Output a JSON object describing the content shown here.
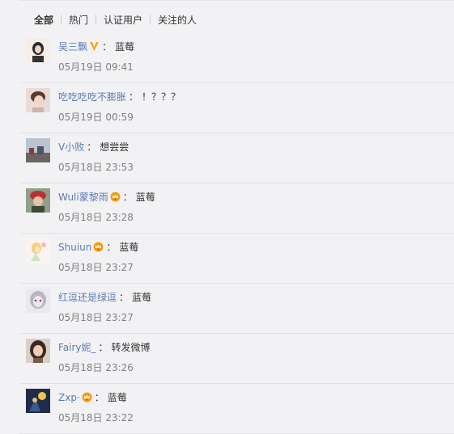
{
  "tabs": [
    "全部",
    "热门",
    "认证用户",
    "关注的人"
  ],
  "comments": [
    {
      "name": "吴三飘",
      "badge": "verified-v-icon",
      "text": "蓝莓",
      "time": "05月19日 09:41"
    },
    {
      "name": "吃吃吃吃不膨胀",
      "badge": "",
      "text": "！？？？",
      "time": "05月19日 00:59"
    },
    {
      "name": "V小败",
      "badge": "",
      "text": "想尝尝",
      "time": "05月18日 23:53"
    },
    {
      "name": "Wuli蒙黎雨",
      "badge": "crown-badge-icon",
      "text": "蓝莓",
      "time": "05月18日 23:28"
    },
    {
      "name": "Shuiun",
      "badge": "crown-badge-icon",
      "text": "蓝莓",
      "time": "05月18日 23:27"
    },
    {
      "name": "红逗还是绿逗",
      "badge": "",
      "text": "蓝莓",
      "time": "05月18日 23:27"
    },
    {
      "name": "Fairy妮_",
      "badge": "",
      "text": "转发微博",
      "time": "05月18日 23:26"
    },
    {
      "name": "Zxp·",
      "badge": "crown-badge-icon",
      "text": "蓝莓",
      "time": "05月18日 23:22"
    }
  ],
  "colors": {
    "link": "#5b7bb0",
    "time": "#808080",
    "verified": "#f5a623",
    "crown": "#f39c12"
  }
}
